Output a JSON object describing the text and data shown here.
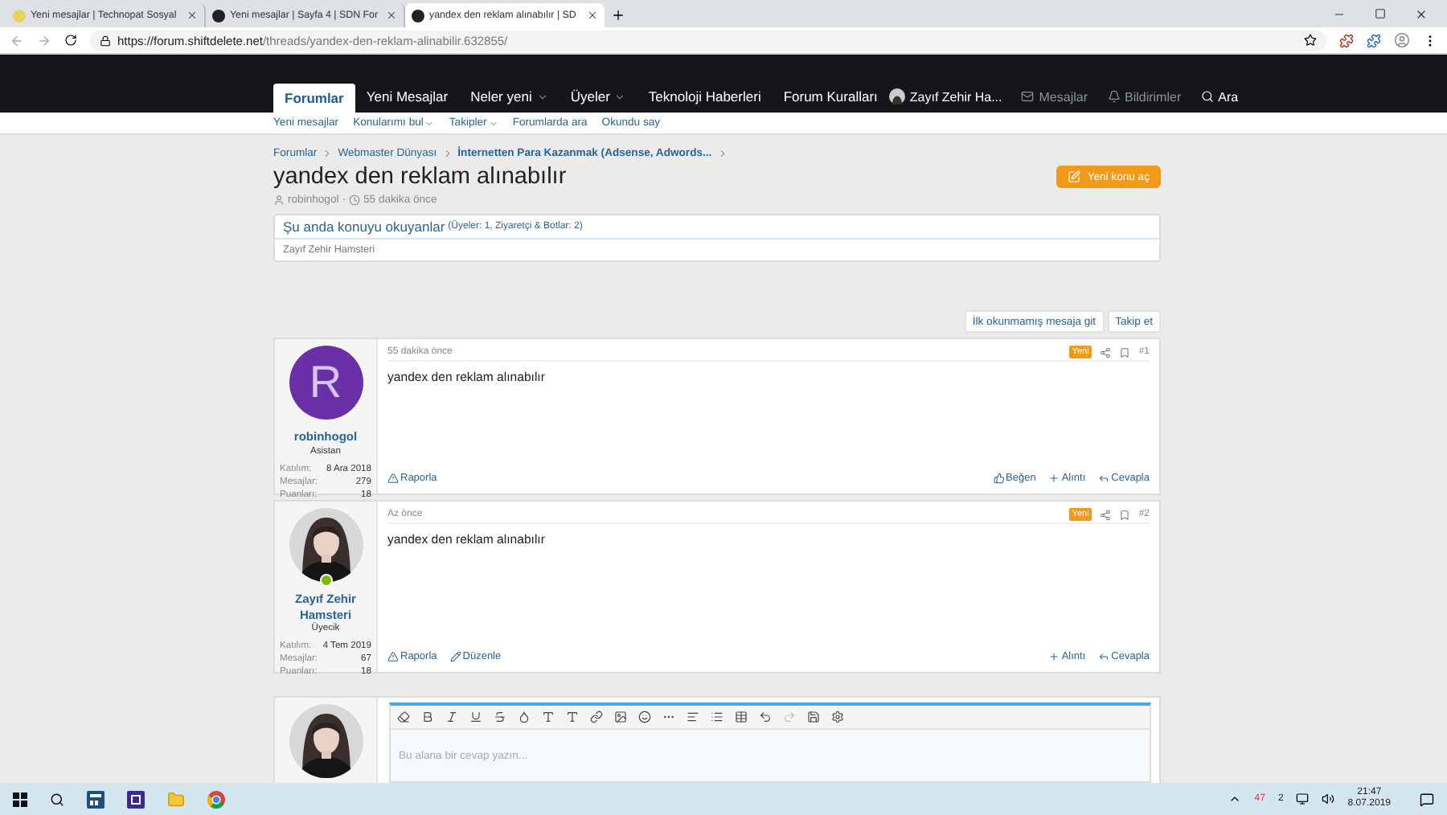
{
  "browser": {
    "tabs": [
      {
        "title": "Yeni mesajlar | Technopat Sosyal",
        "selected": false
      },
      {
        "title": "Yeni mesajlar | Sayfa 4 | SDN For",
        "selected": false
      },
      {
        "title": "yandex den reklam alınabılır | SD",
        "selected": true
      }
    ],
    "url_host": "https://forum.shiftdelete.net",
    "url_path": "/threads/yandex-den-reklam-alinabilir.632855/"
  },
  "nav": {
    "items": [
      {
        "label": "Forumlar",
        "selected": true,
        "dropdown": false
      },
      {
        "label": "Yeni Mesajlar",
        "selected": false,
        "dropdown": false
      },
      {
        "label": "Neler yeni",
        "selected": false,
        "dropdown": true
      },
      {
        "label": "Üyeler",
        "selected": false,
        "dropdown": true
      },
      {
        "label": "Teknoloji Haberleri",
        "selected": false,
        "dropdown": false
      },
      {
        "label": "Forum Kuralları",
        "selected": false,
        "dropdown": false
      }
    ],
    "user": "Zayıf Zehir Ha...",
    "messages": "Mesajlar",
    "alerts": "Bildirimler",
    "search": "Ara"
  },
  "subnav": [
    {
      "label": "Yeni mesajlar",
      "dropdown": false
    },
    {
      "label": "Konularımı bul",
      "dropdown": true
    },
    {
      "label": "Takipler",
      "dropdown": true
    },
    {
      "label": "Forumlarda ara",
      "dropdown": false
    },
    {
      "label": "Okundu say",
      "dropdown": false
    }
  ],
  "breadcrumbs": [
    "Forumlar",
    "Webmaster Dünyası",
    "İnternetten Para Kazanmak (Adsense, Adwords..."
  ],
  "thread": {
    "title": "yandex den reklam alınabılır",
    "author": "robinhogol",
    "time": "55 dakika önce",
    "separator": "·",
    "new_thread_button": "Yeni konu aç"
  },
  "readers": {
    "title": "Şu anda konuyu okuyanlar",
    "detail": "(Üyeler: 1, Ziyaretçi & Botlar: 2)",
    "names": "Zayıf Zehir Hamsteri"
  },
  "thread_buttons": [
    "İlk okunmamış mesaja git",
    "Takip et"
  ],
  "posts": [
    {
      "avatar": {
        "kind": "letter",
        "letter": "R",
        "color": "#6b2fa8"
      },
      "online": false,
      "author": "robinhogol",
      "role": "Asistan",
      "stats": [
        {
          "label": "Katılım:",
          "value": "8 Ara 2018"
        },
        {
          "label": "Mesajlar:",
          "value": "279"
        },
        {
          "label": "Puanları:",
          "value": "18"
        }
      ],
      "time": "55 dakika önce",
      "badge": "Yeni",
      "number": "#1",
      "body": "yandex den reklam alınabılır",
      "left_actions": [
        {
          "kind": "report",
          "label": "Raporla"
        }
      ],
      "right_actions": [
        {
          "kind": "like",
          "label": "Beğen"
        },
        {
          "kind": "quote",
          "label": "Alıntı"
        },
        {
          "kind": "reply",
          "label": "Cevapla"
        }
      ]
    },
    {
      "avatar": {
        "kind": "picture"
      },
      "online": true,
      "author": "Zayıf Zehir Hamsteri",
      "role": "Üyecik",
      "stats": [
        {
          "label": "Katılım:",
          "value": "4 Tem 2019"
        },
        {
          "label": "Mesajlar:",
          "value": "67"
        },
        {
          "label": "Puanları:",
          "value": "18"
        }
      ],
      "time": "Az önce",
      "badge": "Yeni",
      "number": "#2",
      "body": "yandex den reklam alınabılır",
      "left_actions": [
        {
          "kind": "report",
          "label": "Raporla"
        },
        {
          "kind": "edit",
          "label": "Düzenle"
        }
      ],
      "right_actions": [
        {
          "kind": "quote",
          "label": "Alıntı"
        },
        {
          "kind": "reply",
          "label": "Cevapla"
        }
      ]
    }
  ],
  "editor": {
    "placeholder": "Bu alana bir cevap yazın..."
  },
  "taskbar": {
    "tray_count_red": "47",
    "tray_count": "2",
    "time": "21:47",
    "date": "8.07.2019"
  }
}
